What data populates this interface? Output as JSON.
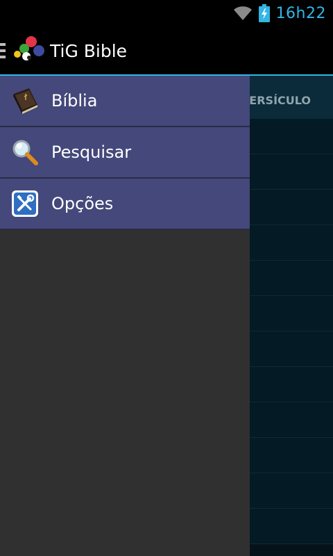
{
  "status_bar": {
    "time": "16h22",
    "icons": [
      "wifi-icon",
      "battery-charging-icon"
    ],
    "accent_color": "#33b5e5"
  },
  "action_bar": {
    "title": "TiG Bible",
    "icons": [
      "drawer-toggle-icon",
      "app-logo-icon"
    ]
  },
  "main": {
    "tab_label": "VERSÍCULO"
  },
  "drawer": {
    "items": [
      {
        "label": "Bíblia",
        "icon": "bible-icon"
      },
      {
        "label": "Pesquisar",
        "icon": "magnifier-icon"
      },
      {
        "label": "Opções",
        "icon": "tools-icon"
      }
    ],
    "item_color": "#44487a"
  }
}
